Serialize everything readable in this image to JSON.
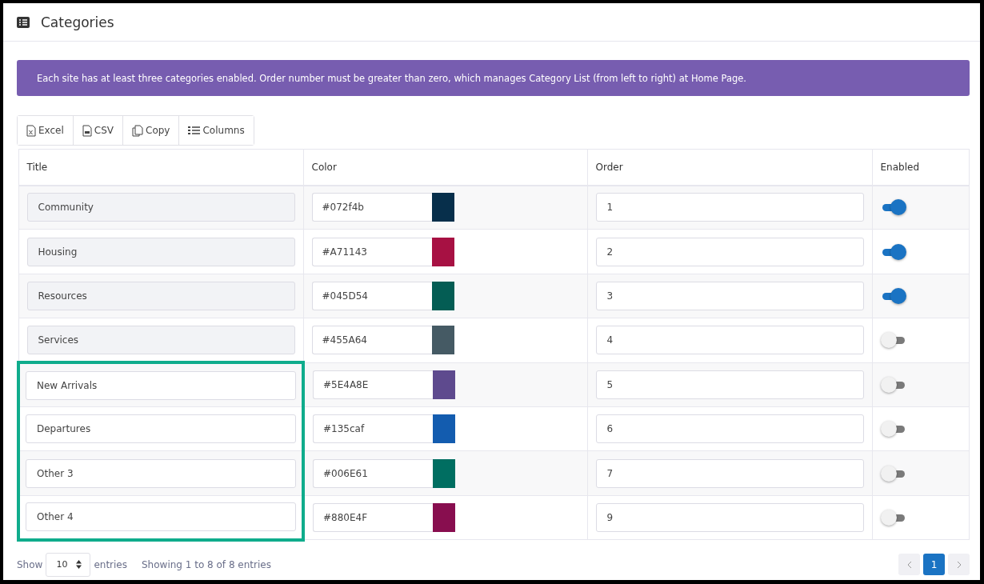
{
  "header": {
    "title": "Categories"
  },
  "alert": {
    "text": "Each site has at least three categories enabled. Order number must be greater than zero, which manages Category List (from left to right) at Home Page."
  },
  "toolbar": [
    {
      "kind": "excel",
      "label": "Excel"
    },
    {
      "kind": "csv",
      "label": "CSV"
    },
    {
      "kind": "copy",
      "label": "Copy"
    },
    {
      "kind": "columns",
      "label": "Columns"
    }
  ],
  "table": {
    "columns": [
      "Title",
      "Color",
      "Order",
      "Enabled"
    ],
    "rows": [
      {
        "title": "Community",
        "title_disabled": true,
        "highlighted": false,
        "color_code": "#072f4b",
        "color": "#072f4b",
        "order": "1",
        "enabled": true
      },
      {
        "title": "Housing",
        "title_disabled": true,
        "highlighted": false,
        "color_code": "#A71143",
        "color": "#a71143",
        "order": "2",
        "enabled": true
      },
      {
        "title": "Resources",
        "title_disabled": true,
        "highlighted": false,
        "color_code": "#045D54",
        "color": "#045d54",
        "order": "3",
        "enabled": true
      },
      {
        "title": "Services",
        "title_disabled": true,
        "highlighted": false,
        "color_code": "#455A64",
        "color": "#455a64",
        "order": "4",
        "enabled": false
      },
      {
        "title": "New Arrivals",
        "title_disabled": false,
        "highlighted": true,
        "color_code": "#5E4A8E",
        "color": "#5e4a8e",
        "order": "5",
        "enabled": false
      },
      {
        "title": "Departures",
        "title_disabled": false,
        "highlighted": true,
        "color_code": "#135caf",
        "color": "#135caf",
        "order": "6",
        "enabled": false
      },
      {
        "title": "Other 3",
        "title_disabled": false,
        "highlighted": true,
        "color_code": "#006E61",
        "color": "#006e61",
        "order": "7",
        "enabled": false
      },
      {
        "title": "Other 4",
        "title_disabled": false,
        "highlighted": true,
        "color_code": "#880E4F",
        "color": "#880e4f",
        "order": "9",
        "enabled": false
      }
    ]
  },
  "footer": {
    "show_label": "Show",
    "page_size": "10",
    "entries_label": "entries",
    "info": "Showing 1 to 8 of 8 entries",
    "pages": [
      {
        "label": "1",
        "selected": true
      }
    ]
  }
}
